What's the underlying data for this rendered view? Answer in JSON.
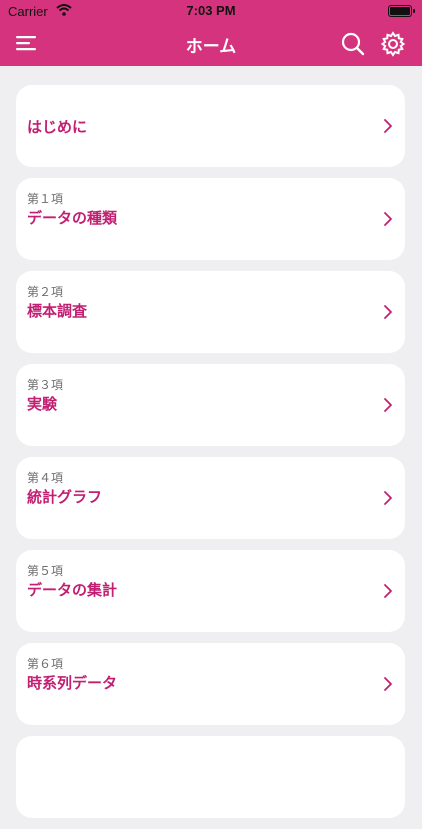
{
  "status_bar": {
    "carrier": "Carrier",
    "time": "7:03 PM"
  },
  "header": {
    "title": "ホーム"
  },
  "icons": {
    "menu": "hamburger-menu-icon",
    "search": "search-icon",
    "settings": "gear-icon",
    "chevron": "chevron-right-icon"
  },
  "colors": {
    "accent": "#d6337e",
    "label": "#c21e72",
    "background": "#efeff1"
  },
  "items": [
    {
      "sub": "",
      "label": "はじめに"
    },
    {
      "sub": "第１項",
      "label": "データの種類"
    },
    {
      "sub": "第２項",
      "label": "標本調査"
    },
    {
      "sub": "第３項",
      "label": "実験"
    },
    {
      "sub": "第４項",
      "label": "統計グラフ"
    },
    {
      "sub": "第５項",
      "label": "データの集計"
    },
    {
      "sub": "第６項",
      "label": "時系列データ"
    }
  ]
}
